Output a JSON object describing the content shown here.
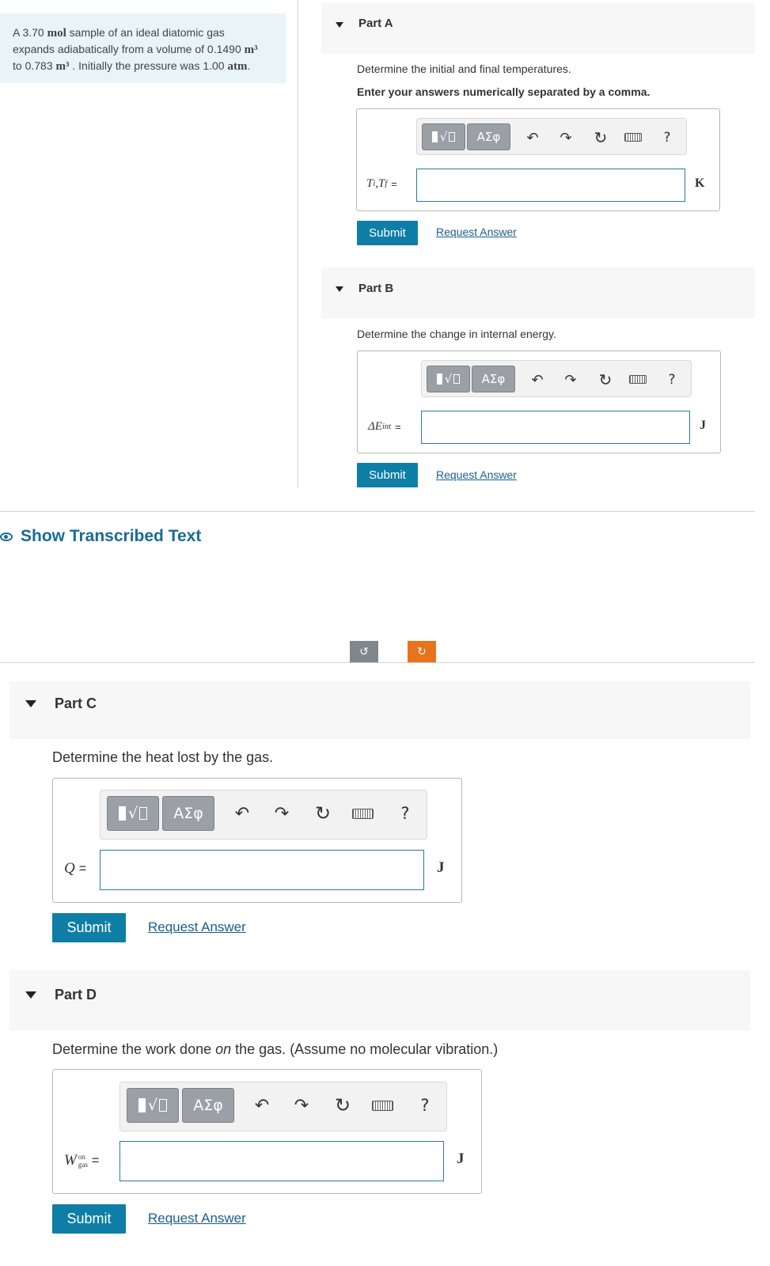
{
  "problem": {
    "line1_pre": "A 3.70 ",
    "line1_unit": "mol",
    "line1_post": " sample of an ideal diatomic gas",
    "line2_pre": "expands adiabatically from a volume of 0.1490 ",
    "line2_unit": "m³",
    "line3_pre": "to 0.783 ",
    "line3_unit": "m³",
    "line3_mid": " . Initially the pressure was 1.00 ",
    "line3_unit2": "atm",
    "line3_post": "."
  },
  "toolbar": {
    "template_btn": "√",
    "symbols_btn": "ΑΣφ",
    "undo": "↶",
    "redo": "↷",
    "reset": "↻",
    "help": "?"
  },
  "parts": [
    {
      "title": "Part A",
      "prompt": "Determine the initial and final temperatures.",
      "instruction": "Enter your answers numerically separated by a comma.",
      "label_main": "T",
      "label_sub1": "i",
      "label_mid": ",T",
      "label_sub2": "f",
      "label_eq": "=",
      "unit": "K",
      "submit": "Submit",
      "request": "Request Answer"
    },
    {
      "title": "Part B",
      "prompt": "Determine the change in internal energy.",
      "label_main": "ΔE",
      "label_sub1": "int",
      "label_eq": "=",
      "unit": "J",
      "submit": "Submit",
      "request": "Request Answer"
    },
    {
      "title": "Part C",
      "prompt": "Determine the heat lost by the gas.",
      "label_main": "Q",
      "label_eq": "=",
      "unit": "J",
      "submit": "Submit",
      "request": "Request Answer"
    },
    {
      "title": "Part D",
      "prompt_pre": "Determine the work done ",
      "prompt_em": "on",
      "prompt_post": " the gas. (Assume no molecular vibration.)",
      "label_main": "W",
      "label_sub_top": "on",
      "label_sub_bottom": "gas",
      "label_eq": "=",
      "unit": "J",
      "submit": "Submit",
      "request": "Request Answer"
    }
  ],
  "show_transcribed": "Show Transcribed Text",
  "rotate": {
    "left": "↺",
    "right": "↻"
  },
  "colors": {
    "accent": "#0e7ea6",
    "link": "#1b5e8c",
    "problem_bg": "#e8f4f7",
    "rotate_active": "#e8731a",
    "rotate_inactive": "#7f868c"
  }
}
